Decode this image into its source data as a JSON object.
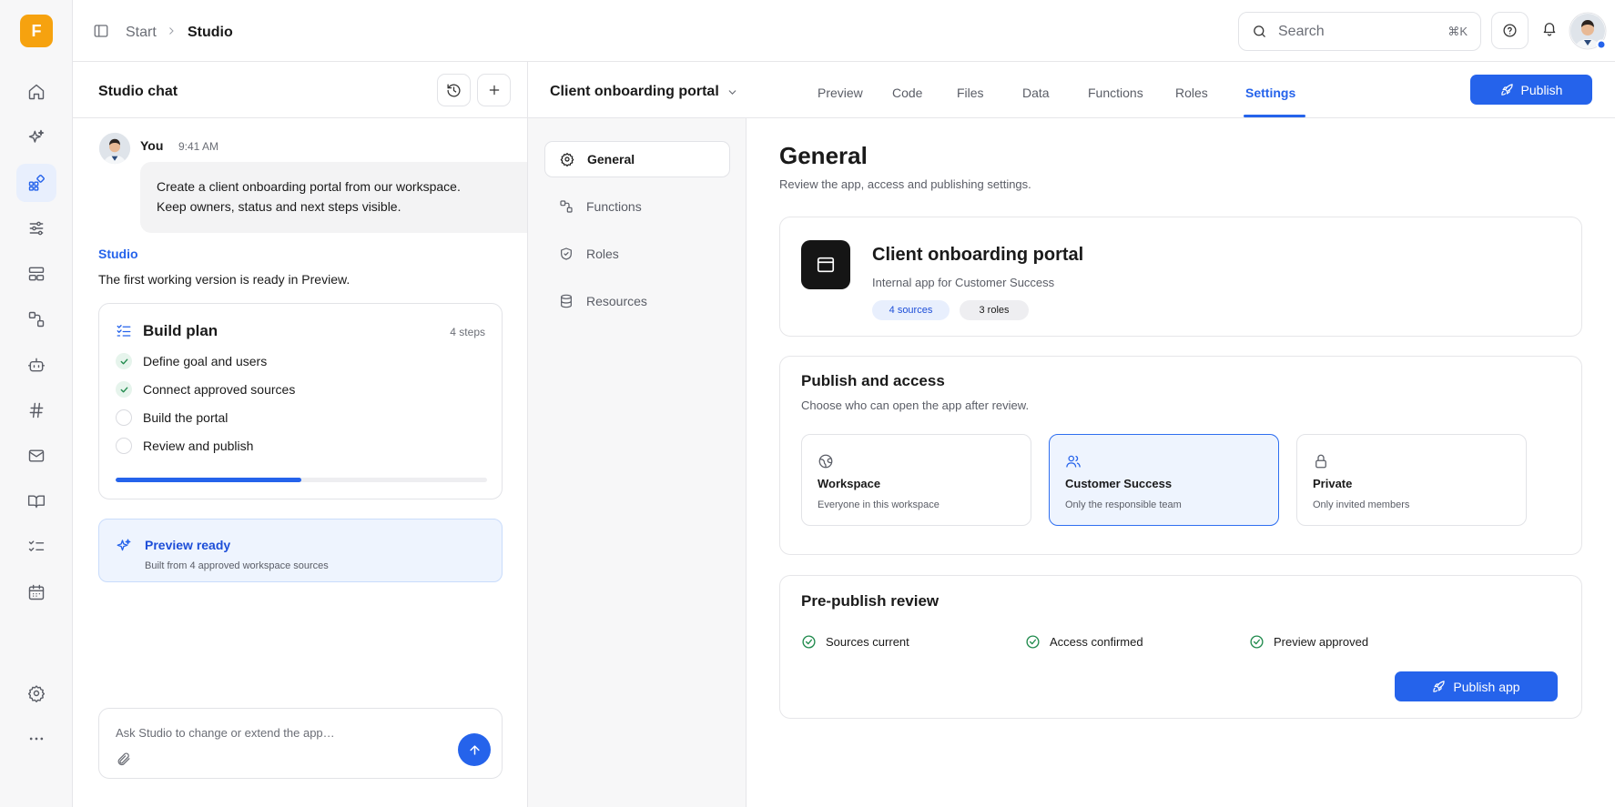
{
  "brand": {
    "logo_letter": "F",
    "accent": "#2563eb",
    "logo_color": "#f6a20f"
  },
  "rail": {
    "items": [
      {
        "name": "home-icon"
      },
      {
        "name": "sparkles-icon"
      },
      {
        "name": "apps-icon",
        "active": true
      },
      {
        "name": "sliders-icon"
      },
      {
        "name": "layout-icon"
      },
      {
        "name": "workflow-icon"
      },
      {
        "name": "bot-icon"
      },
      {
        "name": "hash-icon"
      },
      {
        "name": "mail-icon"
      },
      {
        "name": "book-icon"
      },
      {
        "name": "checklist-icon"
      },
      {
        "name": "calendar-icon"
      }
    ],
    "bottom": [
      {
        "name": "gear-icon"
      },
      {
        "name": "more-icon"
      }
    ]
  },
  "header": {
    "breadcrumb": [
      "Start",
      "Studio"
    ],
    "search": {
      "placeholder": "Search",
      "shortcut": "⌘K"
    }
  },
  "chat": {
    "title": "Studio chat",
    "user_message": {
      "author": "You",
      "time": "9:41 AM",
      "lines": [
        "Create a client onboarding portal from our workspace.",
        "Keep owners, status and next steps visible."
      ]
    },
    "assistant": {
      "author": "Studio",
      "text": "The first working version is ready in Preview."
    },
    "plan": {
      "title": "Build plan",
      "count": "4 steps",
      "steps": [
        {
          "label": "Define goal and users",
          "done": true
        },
        {
          "label": "Connect approved sources",
          "done": true
        },
        {
          "label": "Build the portal",
          "done": false
        },
        {
          "label": "Review and publish",
          "done": false
        }
      ],
      "progress": 0.5
    },
    "preview": {
      "title": "Preview ready",
      "subtitle": "Built from 4 approved workspace sources"
    },
    "composer": {
      "placeholder": "Ask Studio to change or extend the app…"
    }
  },
  "workspace": {
    "app_name": "Client onboarding portal",
    "tabs": [
      {
        "label": "Preview"
      },
      {
        "label": "Code"
      },
      {
        "label": "Files"
      },
      {
        "label": "Data"
      },
      {
        "label": "Functions"
      },
      {
        "label": "Roles"
      },
      {
        "label": "Settings",
        "active": true
      }
    ],
    "publish_label": "Publish"
  },
  "settings_nav": {
    "items": [
      {
        "label": "General",
        "icon": "gear-icon",
        "active": true
      },
      {
        "label": "Functions",
        "icon": "workflow-icon"
      },
      {
        "label": "Roles",
        "icon": "shield-icon"
      },
      {
        "label": "Resources",
        "icon": "database-icon"
      }
    ]
  },
  "general": {
    "title": "General",
    "subtitle": "Review the app, access and publishing settings.",
    "app_card": {
      "title": "Client onboarding portal",
      "description": "Internal app for Customer Success",
      "badges": [
        "4 sources",
        "3 roles"
      ]
    },
    "access": {
      "title": "Publish and access",
      "subtitle": "Choose who can open the app after review.",
      "options": [
        {
          "title": "Workspace",
          "subtitle": "Everyone in this workspace",
          "icon": "globe-icon"
        },
        {
          "title": "Customer Success",
          "subtitle": "Only the responsible team",
          "icon": "users-icon",
          "selected": true
        },
        {
          "title": "Private",
          "subtitle": "Only invited members",
          "icon": "lock-icon"
        }
      ]
    },
    "review": {
      "title": "Pre-publish review",
      "checks": [
        "Sources current",
        "Access confirmed",
        "Preview approved"
      ],
      "button": "Publish app"
    }
  }
}
